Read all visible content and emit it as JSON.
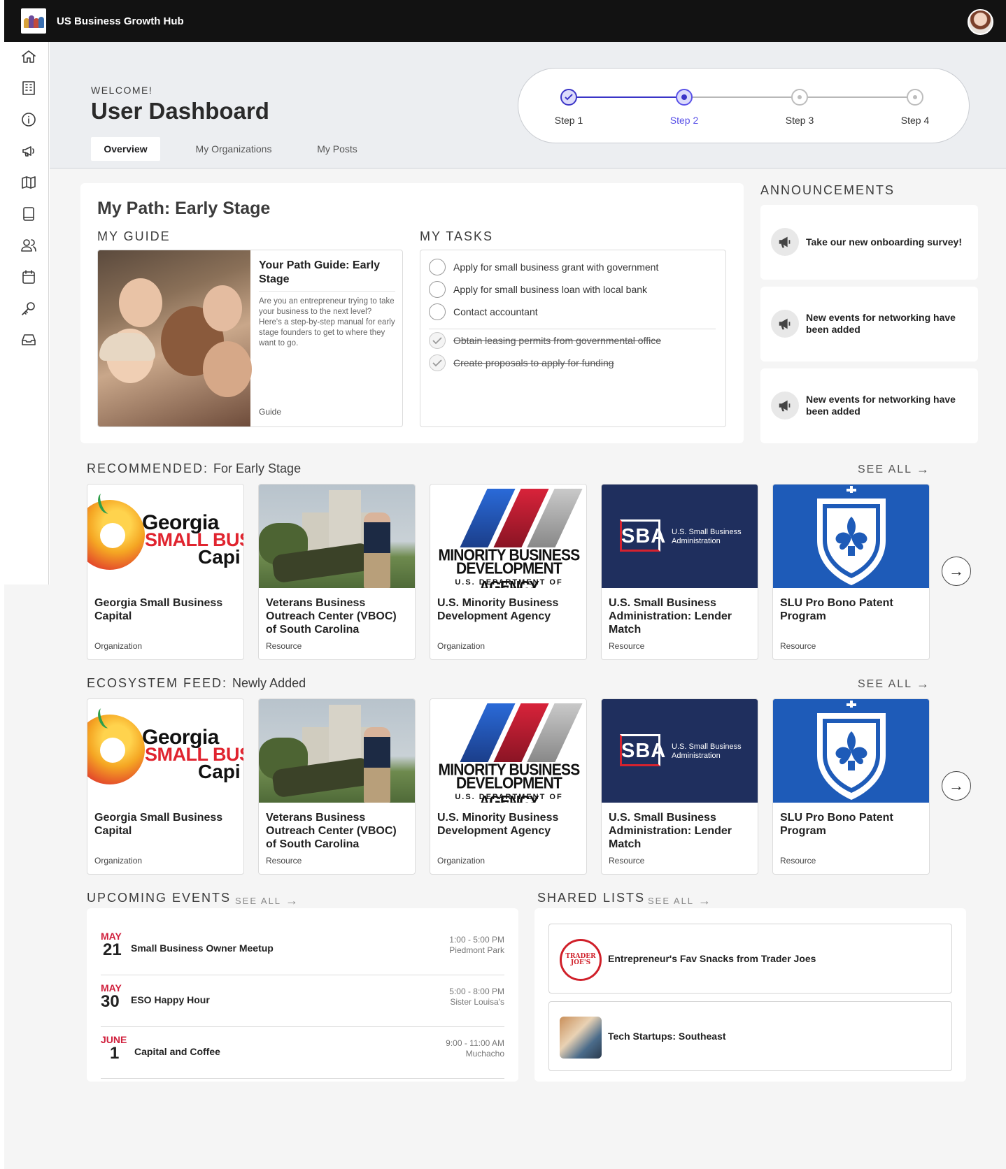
{
  "app": {
    "title": "US Business Growth Hub"
  },
  "sidebar": {
    "items": [
      {
        "name": "home-icon"
      },
      {
        "name": "building-icon"
      },
      {
        "name": "info-icon"
      },
      {
        "name": "megaphone-icon"
      },
      {
        "name": "map-icon"
      },
      {
        "name": "book-icon"
      },
      {
        "name": "users-icon"
      },
      {
        "name": "calendar-icon"
      },
      {
        "name": "key-icon"
      },
      {
        "name": "inbox-icon"
      }
    ]
  },
  "header": {
    "welcome": "WELCOME!",
    "title": "User Dashboard",
    "tabs": [
      {
        "label": "Overview",
        "active": true
      },
      {
        "label": "My Organizations",
        "active": false
      },
      {
        "label": "My Posts",
        "active": false
      }
    ]
  },
  "stepper": {
    "steps": [
      {
        "label": "Step 1",
        "state": "done"
      },
      {
        "label": "Step 2",
        "state": "current"
      },
      {
        "label": "Step 3",
        "state": "todo"
      },
      {
        "label": "Step 4",
        "state": "todo"
      }
    ],
    "accent": "#3b35c7"
  },
  "path": {
    "title": "My Path: Early Stage",
    "guide_label": "MY GUIDE",
    "tasks_label": "MY TASKS",
    "guide": {
      "title": "Your Path Guide: Early Stage",
      "description": "Are you an entrepreneur trying to take your business to the next level? Here's a step-by-step manual for early stage founders to get to where they want to go.",
      "type": "Guide"
    },
    "tasks": [
      {
        "label": "Apply for small business grant with government",
        "done": false
      },
      {
        "label": "Apply for small business loan with local bank",
        "done": false
      },
      {
        "label": "Contact accountant",
        "done": false
      },
      {
        "label": "Obtain leasing permits from governmental office",
        "done": true
      },
      {
        "label": "Create proposals to apply for funding",
        "done": true
      }
    ]
  },
  "announcements": {
    "label": "ANNOUNCEMENTS",
    "items": [
      {
        "text": "Take our new onboarding survey!"
      },
      {
        "text": "New events for networking have been added"
      },
      {
        "text": "New events for networking have been added"
      }
    ]
  },
  "recommended": {
    "label": "RECOMMENDED:",
    "sublabel": "For Early Stage",
    "see_all": "SEE ALL",
    "cards": [
      {
        "name": "Georgia Small Business Capital",
        "type": "Organization",
        "image": "georgia"
      },
      {
        "name": "Veterans Business Outreach Center (VBOC) of South Carolina",
        "type": "Resource",
        "image": "veterans"
      },
      {
        "name": "U.S. Minority Business Development Agency",
        "type": "Organization",
        "image": "mbda"
      },
      {
        "name": "U.S. Small Business Administration: Lender Match",
        "type": "Resource",
        "image": "sba"
      },
      {
        "name": "SLU Pro Bono Patent Program",
        "type": "Resource",
        "image": "slu"
      }
    ]
  },
  "ecosystem": {
    "label": "ECOSYSTEM FEED:",
    "sublabel": "Newly Added",
    "see_all": "SEE ALL",
    "cards": [
      {
        "name": "Georgia Small Business Capital",
        "type": "Organization",
        "image": "georgia"
      },
      {
        "name": "Veterans Business Outreach Center (VBOC) of South Carolina",
        "type": "Resource",
        "image": "veterans"
      },
      {
        "name": "U.S. Minority Business Development Agency",
        "type": "Organization",
        "image": "mbda"
      },
      {
        "name": "U.S. Small Business Administration: Lender Match",
        "type": "Resource",
        "image": "sba"
      },
      {
        "name": "SLU Pro Bono Patent Program",
        "type": "Resource",
        "image": "slu"
      }
    ]
  },
  "logos": {
    "georgia": {
      "line1": "Georgia",
      "line2": "SMALL BUSIN",
      "line3": "Capi"
    },
    "mbda": {
      "line1": "MINORITY BUSINESS",
      "line2": "DEVELOPMENT AGENCY",
      "line3": "U.S. DEPARTMENT OF COMMERCE"
    },
    "sba": {
      "mark": "SBA",
      "sub1": "U.S. Small Business",
      "sub2": "Administration"
    }
  },
  "events": {
    "label": "UPCOMING EVENTS",
    "see_all": "SEE ALL",
    "items": [
      {
        "month": "MAY",
        "day": "21",
        "title": "Small Business Owner Meetup",
        "time": "1:00 - 5:00 PM",
        "place": "Piedmont Park"
      },
      {
        "month": "MAY",
        "day": "30",
        "title": "ESO Happy Hour",
        "time": "5:00 - 8:00 PM",
        "place": "Sister Louisa's"
      },
      {
        "month": "JUNE",
        "day": "1",
        "title": "Capital and Coffee",
        "time": "9:00 - 11:00 AM",
        "place": "Muchacho"
      }
    ]
  },
  "lists": {
    "label": "SHARED LISTS",
    "see_all": "SEE ALL",
    "items": [
      {
        "title": "Entrepreneur's Fav Snacks from Trader Joes",
        "thumb_text": "TRADER JOE'S"
      },
      {
        "title": "Tech Startups: Southeast"
      }
    ]
  }
}
